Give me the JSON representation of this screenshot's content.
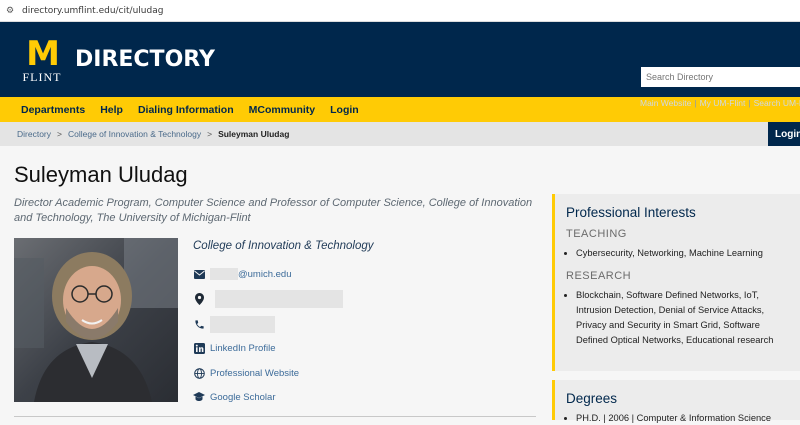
{
  "browser": {
    "url": "directory.umflint.edu/cit/uludag"
  },
  "header": {
    "logo_m": "M",
    "logo_text": "FLINT",
    "title": "DIRECTORY",
    "search_placeholder": "Search Directory",
    "links": [
      "Main Website",
      "My UM-Flint",
      "Search UM-Flint"
    ],
    "link_separator": "|",
    "bg_color": "#00274c",
    "accent_color": "#ffcb05"
  },
  "nav": {
    "items": [
      "Departments",
      "Help",
      "Dialing Information",
      "MCommunity",
      "Login"
    ]
  },
  "breadcrumb": {
    "items": [
      "Directory",
      "College of Innovation & Technology"
    ],
    "separator": ">",
    "current": "Suleyman Uludag",
    "login_label": "Login"
  },
  "profile": {
    "name": "Suleyman Uludag",
    "title": "Director Academic Program, Computer Science and Professor of Computer Science, College of Innovation and Technology, The University of Michigan-Flint",
    "college": "College of Innovation & Technology",
    "email_suffix": "@umich.edu",
    "linkedin": "LinkedIn Profile",
    "website": "Professional Website",
    "scholar": "Google Scholar"
  },
  "interests": {
    "heading": "Professional Interests",
    "teaching_label": "TEACHING",
    "teaching": [
      "Cybersecurity, Networking, Machine Learning"
    ],
    "research_label": "RESEARCH",
    "research": [
      "Blockchain, Software Defined Networks, IoT, Intrusion Detection, Denial of Service Attacks, Privacy and Security in Smart Grid, Software Defined Optical Networks, Educational research"
    ]
  },
  "degrees": {
    "heading": "Degrees",
    "items": [
      "PH.D. | 2006 | Computer & Information Science"
    ]
  }
}
